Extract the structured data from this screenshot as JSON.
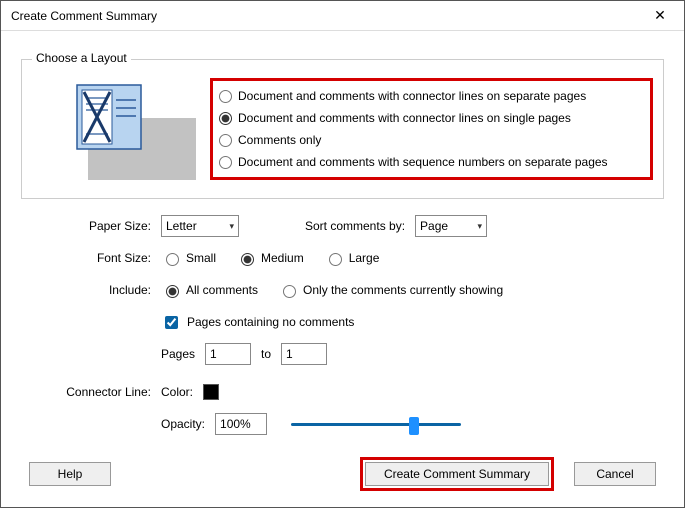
{
  "window": {
    "title": "Create Comment Summary"
  },
  "group": {
    "label": "Choose a Layout"
  },
  "layout_options": {
    "opt1": "Document and comments with connector lines on separate pages",
    "opt2": "Document and comments with connector lines on single pages",
    "opt3": "Comments only",
    "opt4": "Document and comments with sequence numbers on separate pages"
  },
  "labels": {
    "paper_size": "Paper Size:",
    "sort_by": "Sort comments by:",
    "font_size": "Font Size:",
    "include": "Include:",
    "pages": "Pages",
    "to": "to",
    "connector_line": "Connector Line:",
    "color": "Color:",
    "opacity": "Opacity:"
  },
  "paper_size": {
    "value": "Letter"
  },
  "sort_by": {
    "value": "Page"
  },
  "font_size": {
    "small": "Small",
    "medium": "Medium",
    "large": "Large"
  },
  "include": {
    "all": "All comments",
    "showing": "Only the comments currently showing"
  },
  "check_no_comments": "Pages containing no comments",
  "page_from": "1",
  "page_to": "1",
  "opacity_value": "100%",
  "buttons": {
    "help": "Help",
    "create": "Create Comment Summary",
    "cancel": "Cancel"
  }
}
